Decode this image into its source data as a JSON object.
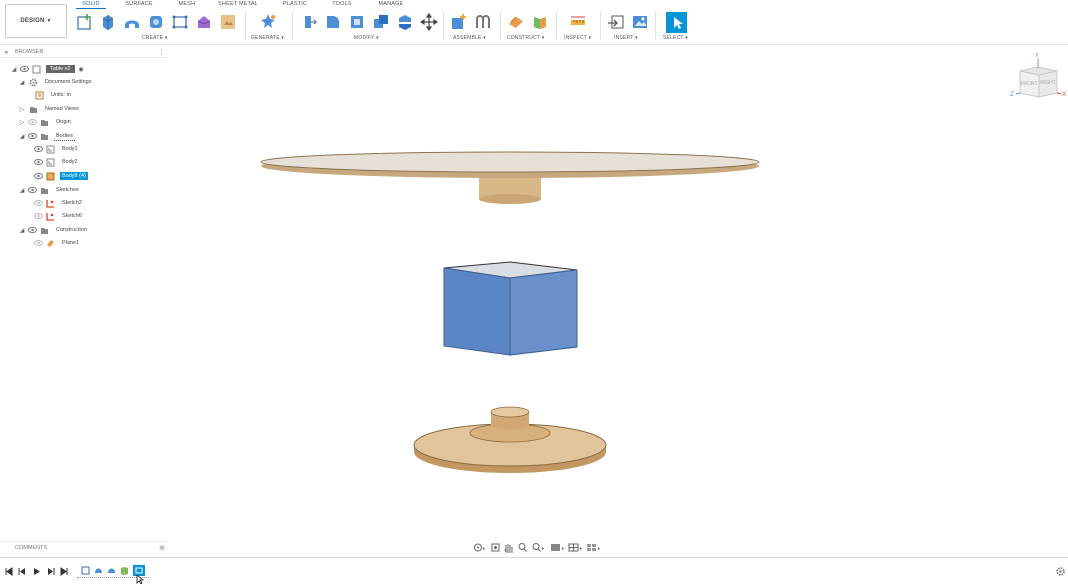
{
  "workspace": {
    "label": "DESIGN"
  },
  "tabs": [
    {
      "label": "SOLID",
      "active": true
    },
    {
      "label": "SURFACE",
      "active": false
    },
    {
      "label": "MESH",
      "active": false
    },
    {
      "label": "SHEET METAL",
      "active": false
    },
    {
      "label": "PLASTIC",
      "active": false
    },
    {
      "label": "TOOLS",
      "active": false
    },
    {
      "label": "MANAGE",
      "active": false
    }
  ],
  "groups": [
    {
      "label": "CREATE"
    },
    {
      "label": "GENERATE"
    },
    {
      "label": "MODIFY"
    },
    {
      "label": "ASSEMBLE"
    },
    {
      "label": "CONSTRUCT"
    },
    {
      "label": "INSPECT"
    },
    {
      "label": "INSERT"
    },
    {
      "label": "SELECT"
    }
  ],
  "browser": {
    "title": "BROWSER",
    "tree": [
      {
        "label": "Table v2",
        "icon": "document-icon"
      },
      {
        "label": "Document Settings",
        "icon": "gear-icon"
      },
      {
        "label": "Units: in",
        "icon": "units-icon"
      },
      {
        "label": "Named Views",
        "icon": "folder-icon"
      },
      {
        "label": "Origin",
        "icon": "folder-icon"
      },
      {
        "label": "Bodies",
        "icon": "folder-icon"
      },
      {
        "label": "Body1",
        "icon": "body-icon"
      },
      {
        "label": "Body2",
        "icon": "body-icon"
      },
      {
        "label": "Body8 (4)",
        "icon": "body-icon",
        "selected": true
      },
      {
        "label": "Sketches",
        "icon": "folder-icon"
      },
      {
        "label": "Sketch2",
        "icon": "sketch-icon"
      },
      {
        "label": "Sketch6",
        "icon": "sketch-icon"
      },
      {
        "label": "Construction",
        "icon": "folder-icon"
      },
      {
        "label": "Plane1",
        "icon": "plane-icon"
      }
    ]
  },
  "comments": {
    "title": "COMMENTS"
  },
  "viewcube": {
    "front": "FRONT",
    "right": "RIGHT",
    "axis_x": "X",
    "axis_y": "Y",
    "axis_z": "Z"
  },
  "colors": {
    "accent": "#0696d7",
    "wood": "#d9b98c",
    "box": "#5b86c6"
  }
}
